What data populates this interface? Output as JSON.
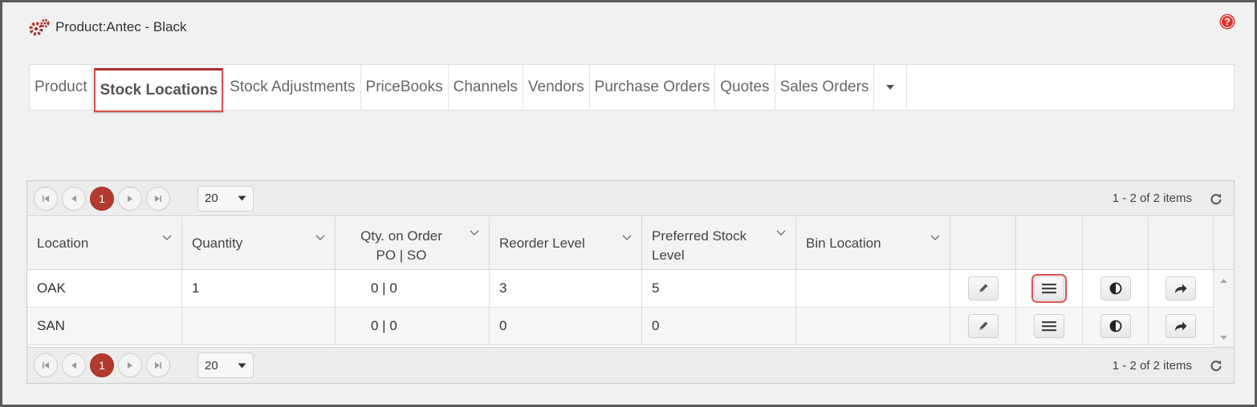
{
  "header": {
    "title": "Product:Antec - Black",
    "icon": "gears-icon",
    "help_icon": "help-icon",
    "accent": "#b33a2f"
  },
  "tabs": [
    {
      "label": "Product",
      "active": false
    },
    {
      "label": "Stock Locations",
      "active": true
    },
    {
      "label": "Stock Adjustments",
      "active": false
    },
    {
      "label": "PriceBooks",
      "active": false
    },
    {
      "label": "Channels",
      "active": false
    },
    {
      "label": "Vendors",
      "active": false
    },
    {
      "label": "Purchase Orders",
      "active": false
    },
    {
      "label": "Quotes",
      "active": false
    },
    {
      "label": "Sales Orders",
      "active": false
    }
  ],
  "pager": {
    "current_page": "1",
    "page_size": "20",
    "info": "1 - 2 of 2 items"
  },
  "columns": [
    {
      "line1": "Location",
      "line2": ""
    },
    {
      "line1": "Quantity",
      "line2": ""
    },
    {
      "line1": "Qty. on Order",
      "line2": "PO | SO"
    },
    {
      "line1": "Reorder Level",
      "line2": ""
    },
    {
      "line1": "Preferred Stock",
      "line2": "Level"
    },
    {
      "line1": "Bin Location",
      "line2": ""
    }
  ],
  "rows": [
    {
      "location": "OAK",
      "quantity": "1",
      "qty_on_order": "0 | 0",
      "reorder_level": "3",
      "preferred_stock_level": "5",
      "bin_location": ""
    },
    {
      "location": "SAN",
      "quantity": "",
      "qty_on_order": "0 | 0",
      "reorder_level": "0",
      "preferred_stock_level": "0",
      "bin_location": ""
    }
  ],
  "row_actions": [
    "pencil-icon",
    "menu-icon",
    "contrast-icon",
    "share-icon"
  ]
}
